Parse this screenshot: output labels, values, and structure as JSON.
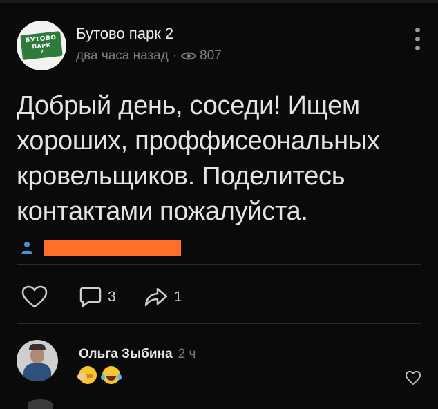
{
  "post": {
    "group_avatar_text": [
      "БУТОВО",
      "ПАРК",
      "2"
    ],
    "group_name": "Бутово парк 2",
    "time": "два часа назад",
    "dot": "·",
    "views": "807",
    "text": "Добрый день, соседи! Ищем хороших, проффисеональных кровельщиков. Поделитесь контактами пожалуйста.",
    "redaction_color": "#ff6f2a"
  },
  "actions": {
    "comments_count": "3",
    "shares_count": "1"
  },
  "comment": {
    "author": "Ольга Зыбина",
    "time": "2 ч",
    "emojis": [
      "face-palm-emoji",
      "laughing-tears-emoji"
    ]
  },
  "colors": {
    "background": "#0a0a0a",
    "text": "#e4e4e4",
    "muted": "#7d7d7d",
    "badge_green": "#2f7b3b"
  }
}
